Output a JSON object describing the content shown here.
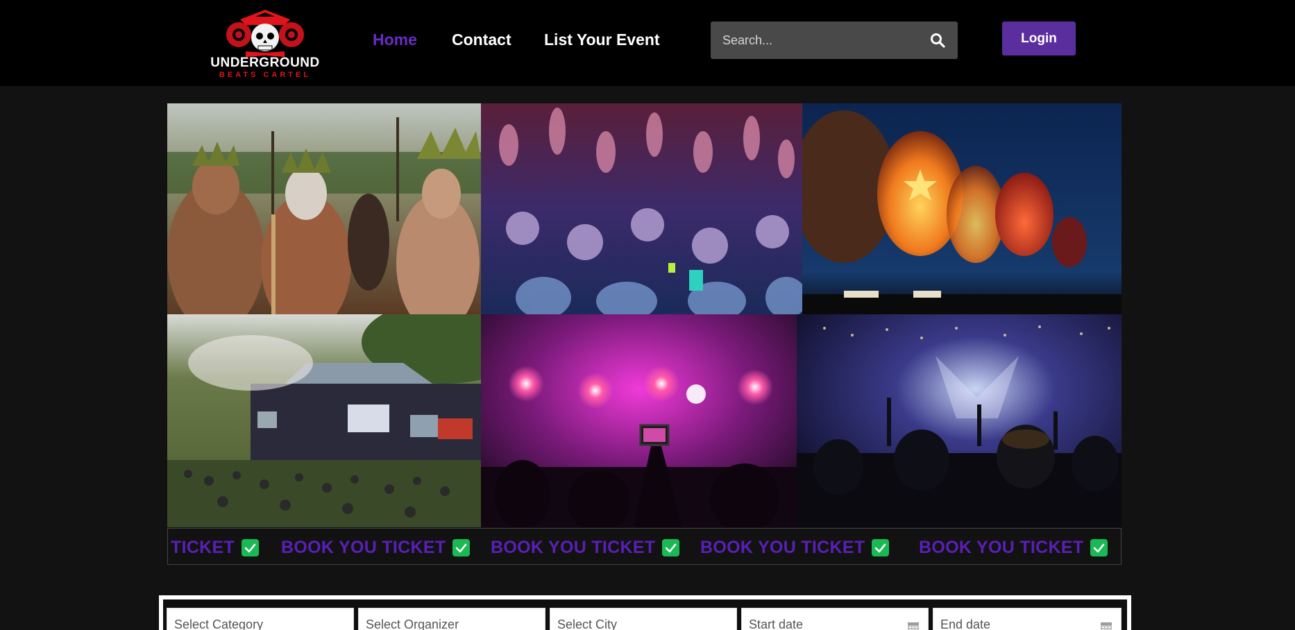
{
  "header": {
    "logo": {
      "line1": "UNDERGROUND",
      "line2": "BEATS CARTEL",
      "icon": "pirate-skull-logo"
    },
    "nav": [
      {
        "label": "Home",
        "active": true
      },
      {
        "label": "Contact",
        "active": false
      },
      {
        "label": "List Your Event",
        "active": false
      }
    ],
    "search": {
      "placeholder": "Search...",
      "icon": "search-icon"
    },
    "login_label": "Login"
  },
  "gallery": {
    "images": [
      "tribal-festival-crowd",
      "rave-crowd-hands-up",
      "hot-air-balloons-night",
      "outdoor-festival-stage",
      "pink-stage-lights-phone",
      "concert-crowd-silhouettes"
    ]
  },
  "ticker": {
    "items": [
      "TICKET",
      "BOOK YOU TICKET",
      "BOOK YOU TICKET",
      "BOOK YOU TICKET",
      "BOOK YOU TICKET"
    ],
    "icon": "check-icon"
  },
  "filters": {
    "category": "Select Category",
    "organizer": "Select Organizer",
    "city": "Select City",
    "start_date": "Start date",
    "end_date": "End date",
    "date_icon": "calendar-icon"
  },
  "colors": {
    "accent": "#5b2e9e",
    "active_nav": "#6a2cc4",
    "ticker_text": "#5a1fb8",
    "check": "#19b954",
    "background": "#121212"
  }
}
